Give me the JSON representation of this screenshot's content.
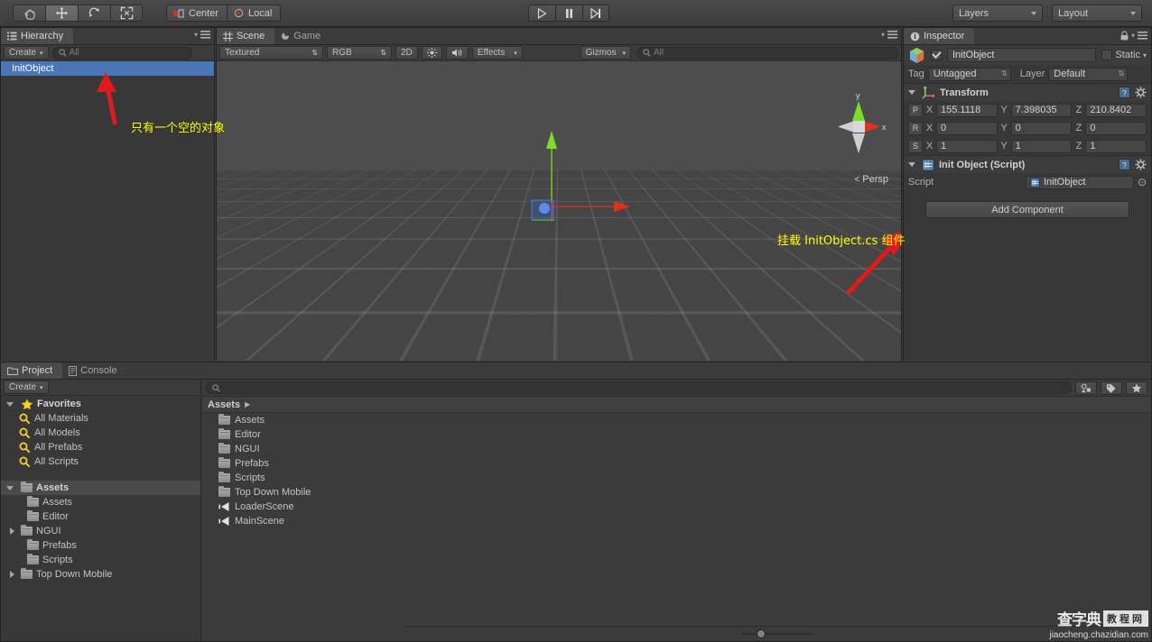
{
  "toolbar": {
    "transform_tools": [
      {
        "name": "hand-tool",
        "active": false
      },
      {
        "name": "move-tool",
        "active": true
      },
      {
        "name": "rotate-tool",
        "active": false
      },
      {
        "name": "scale-tool",
        "active": false
      }
    ],
    "pivot_label": "Center",
    "handle_label": "Local",
    "play_label": "play-icon",
    "pause_label": "pause-icon",
    "step_label": "step-icon",
    "layers_label": "Layers",
    "layout_label": "Layout"
  },
  "hierarchy": {
    "tab_label": "Hierarchy",
    "create_label": "Create",
    "search_placeholder": "All",
    "items": [
      {
        "label": "InitObject",
        "selected": true
      }
    ]
  },
  "scene": {
    "tabs": [
      {
        "label": "Scene",
        "active": true
      },
      {
        "label": "Game",
        "active": false
      }
    ],
    "draw_mode": "Textured",
    "color_mode": "RGB",
    "mode_2d": "2D",
    "lighting_icon": "sun-icon",
    "audio_icon": "speaker-icon",
    "effects_label": "Effects",
    "gizmos_label": "Gizmos",
    "search_placeholder": "All",
    "axis_x": "x",
    "axis_y": "y",
    "perspective_label": "Persp"
  },
  "inspector": {
    "tab_label": "Inspector",
    "object_name": "InitObject",
    "object_enabled": true,
    "static_label": "Static",
    "static_checked": false,
    "tag_label": "Tag",
    "tag_value": "Untagged",
    "layer_label": "Layer",
    "layer_value": "Default",
    "transform": {
      "title": "Transform",
      "position_key": "P",
      "rotation_key": "R",
      "scale_key": "S",
      "position": {
        "x": "155.1118",
        "y": "7.398035",
        "z": "210.8402"
      },
      "rotation": {
        "x": "0",
        "y": "0",
        "z": "0"
      },
      "scale": {
        "x": "1",
        "y": "1",
        "z": "1"
      },
      "axis_x": "X",
      "axis_y": "Y",
      "axis_z": "Z"
    },
    "script_component": {
      "title": "Init Object (Script)",
      "script_label": "Script",
      "script_value": "InitObject"
    },
    "add_component_label": "Add Component"
  },
  "project": {
    "tabs": [
      {
        "label": "Project",
        "active": true
      },
      {
        "label": "Console",
        "active": false
      }
    ],
    "create_label": "Create",
    "search_placeholder": "",
    "favorites": {
      "label": "Favorites",
      "items": [
        "All Materials",
        "All Models",
        "All Prefabs",
        "All Scripts"
      ]
    },
    "assets_tree": {
      "label": "Assets",
      "items": [
        {
          "label": "Assets",
          "expandable": false
        },
        {
          "label": "Editor",
          "expandable": false
        },
        {
          "label": "NGUI",
          "expandable": true
        },
        {
          "label": "Prefabs",
          "expandable": false
        },
        {
          "label": "Scripts",
          "expandable": false
        },
        {
          "label": "Top Down Mobile",
          "expandable": true
        }
      ]
    },
    "breadcrumb": "Assets",
    "assets_list": [
      {
        "label": "Assets",
        "type": "folder"
      },
      {
        "label": "Editor",
        "type": "folder"
      },
      {
        "label": "NGUI",
        "type": "folder"
      },
      {
        "label": "Prefabs",
        "type": "folder"
      },
      {
        "label": "Scripts",
        "type": "folder"
      },
      {
        "label": "Top Down Mobile",
        "type": "folder"
      },
      {
        "label": "LoaderScene",
        "type": "scene"
      },
      {
        "label": "MainScene",
        "type": "scene"
      }
    ]
  },
  "annotations": [
    {
      "text": "只有一个空的对象",
      "color": "#ffff00"
    },
    {
      "text": "挂载 InitObject.cs 组件",
      "color": "#ffff00"
    }
  ],
  "watermark": {
    "cn": "查字典",
    "box": "教程网",
    "url": "jiaocheng.chazidian.com"
  },
  "colors": {
    "selection": "#4a76b8",
    "annotation": "#ffff00",
    "arrow": "#e01b1b",
    "axis_x": "#e03020",
    "axis_y": "#7ddb2a"
  }
}
